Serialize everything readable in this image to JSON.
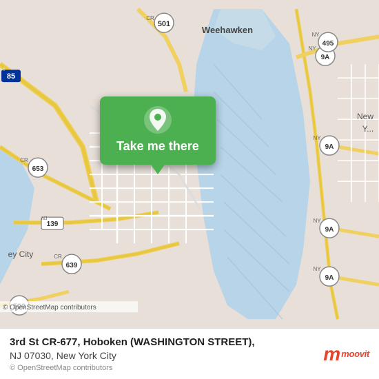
{
  "map": {
    "popup": {
      "label": "Take me there"
    },
    "attribution": "© OpenStreetMap contributors"
  },
  "bottom_bar": {
    "address_line1": "3rd St CR-677, Hoboken (WASHINGTON STREET),",
    "address_line2": "NJ 07030, New York City"
  },
  "branding": {
    "moovit_label": "moovit"
  }
}
